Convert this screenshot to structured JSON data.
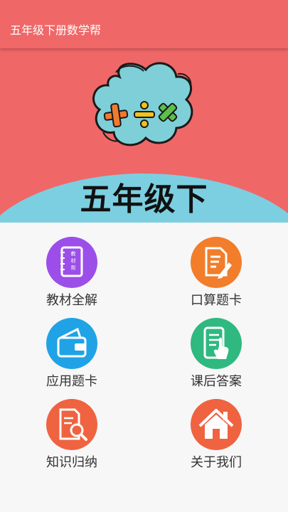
{
  "appbar": {
    "title": "五年级下册数学帮"
  },
  "banner": {
    "grade_text": "五年级下",
    "symbols": "+ ÷ ×",
    "colors": {
      "background": "#f06767",
      "cloud": "#7fcfd8",
      "arc": "#7ccfe0"
    }
  },
  "menu": {
    "items": [
      {
        "label": "教材全解",
        "icon": "textbook-icon",
        "color": "#9c4ee9",
        "icon_text": "教材帮"
      },
      {
        "label": "口算题卡",
        "icon": "document-edit-icon",
        "color": "#f27d2a"
      },
      {
        "label": "应用题卡",
        "icon": "wallet-icon",
        "color": "#1fa3e6"
      },
      {
        "label": "课后答案",
        "icon": "tablet-touch-icon",
        "color": "#2fb880"
      },
      {
        "label": "知识归纳",
        "icon": "document-search-icon",
        "color": "#ef6340"
      },
      {
        "label": "关于我们",
        "icon": "home-icon",
        "color": "#ef6340"
      }
    ]
  }
}
